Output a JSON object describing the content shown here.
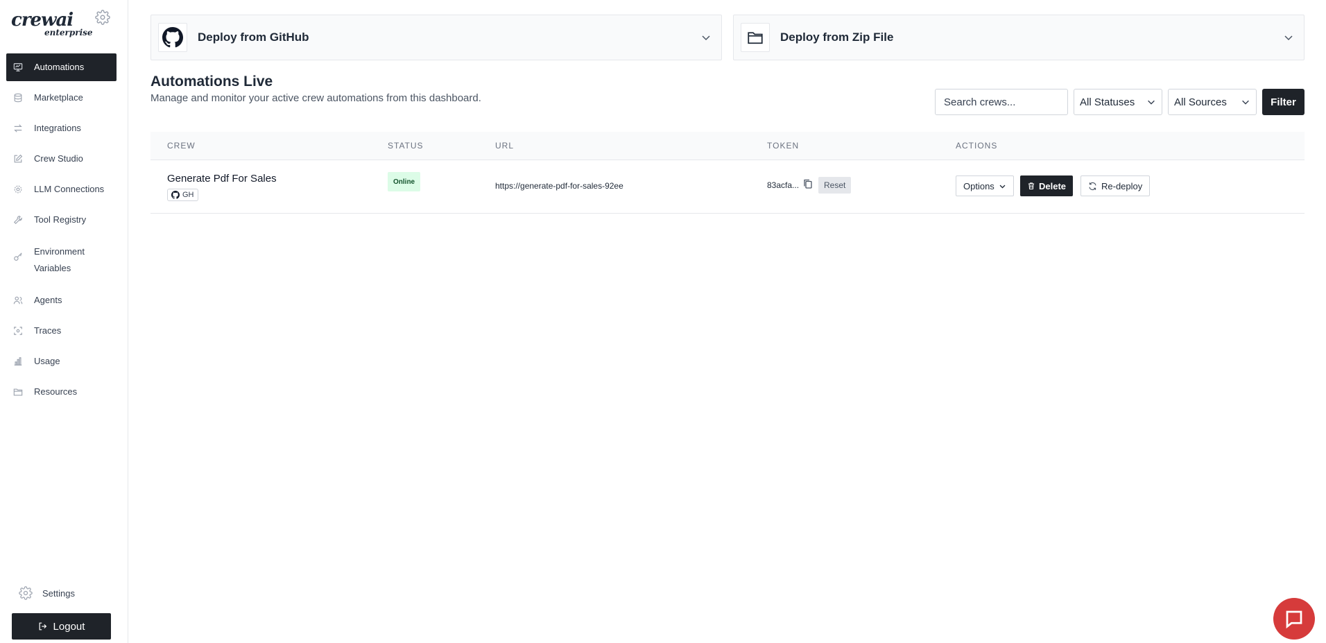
{
  "brand": {
    "logo_text": "crewai",
    "logo_sub": "enterprise"
  },
  "sidebar": {
    "items": [
      {
        "label": "Automations",
        "icon": "monitor-icon",
        "active": true
      },
      {
        "label": "Marketplace",
        "icon": "database-icon"
      },
      {
        "label": "Integrations",
        "icon": "arrows-exchange-icon"
      },
      {
        "label": "Crew Studio",
        "icon": "pencil-square-icon"
      },
      {
        "label": "LLM Connections",
        "icon": "gear-icon"
      },
      {
        "label": "Tool Registry",
        "icon": "wrench-icon"
      },
      {
        "label": "Environment Variables",
        "icon": "key-icon"
      },
      {
        "label": "Agents",
        "icon": "users-icon"
      },
      {
        "label": "Traces",
        "icon": "scan-icon"
      },
      {
        "label": "Usage",
        "icon": "bar-chart-icon"
      },
      {
        "label": "Resources",
        "icon": "folder-icon"
      }
    ],
    "settings_label": "Settings",
    "logout_label": "Logout"
  },
  "deploy": {
    "github_title": "Deploy from GitHub",
    "zip_title": "Deploy from Zip File"
  },
  "header": {
    "title": "Automations Live",
    "subtitle": "Manage and monitor your active crew automations from this dashboard."
  },
  "filters": {
    "search_placeholder": "Search crews...",
    "status_value": "All Statuses",
    "source_value": "All Sources",
    "filter_label": "Filter"
  },
  "table": {
    "columns": [
      "CREW",
      "STATUS",
      "URL",
      "TOKEN",
      "ACTIONS"
    ],
    "rows": [
      {
        "crew": "Generate Pdf For Sales",
        "source_badge": "GH",
        "status": "Online",
        "url": "https://generate-pdf-for-sales-92ee",
        "token": "83acfa...",
        "reset_label": "Reset",
        "options_label": "Options",
        "delete_label": "Delete",
        "redeploy_label": "Re-deploy"
      }
    ]
  },
  "colors": {
    "dark": "#1f2329",
    "status_online_bg": "#dcfce7",
    "chat": "#d63b3b",
    "logo_accent": "#e04e3b"
  }
}
